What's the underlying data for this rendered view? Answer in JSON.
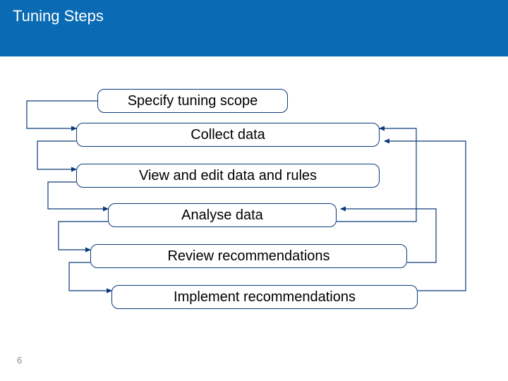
{
  "header": {
    "title": "Tuning Steps"
  },
  "steps": [
    {
      "label": "Specify tuning scope"
    },
    {
      "label": "Collect data"
    },
    {
      "label": "View and edit data and rules"
    },
    {
      "label": "Analyse data"
    },
    {
      "label": "Review recommendations"
    },
    {
      "label": "Implement recommendations"
    }
  ],
  "page_number": "6",
  "colors": {
    "header_bg": "#0a6ab4",
    "box_border": "#0a3a7a",
    "connector": "#0a3a7a"
  }
}
